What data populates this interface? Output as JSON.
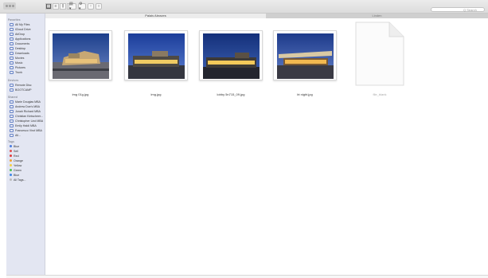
{
  "toolbar": {
    "view_seg_labels": [
      "▦",
      "≡",
      "⫼",
      "⊟"
    ],
    "arrange_label": "▤ ▾",
    "action_label": "⚙ ▾",
    "share_label": "↑",
    "tag_label": "○",
    "search_placeholder": "Q Search"
  },
  "tabs": [
    {
      "label": "Palais Abrazes"
    },
    {
      "label": "Linden"
    }
  ],
  "sidebar": {
    "favorites_title": "Favorites",
    "favorites": [
      "All My Files",
      "iCloud Drive",
      "AirDrop",
      "Applications",
      "Documents",
      "Desktop",
      "Downloads",
      "Movies",
      "Music",
      "Pictures",
      "Trunk"
    ],
    "devices_title": "Devices",
    "devices": [
      "Remote Disc",
      "BOOTCAMP"
    ],
    "shared_title": "Shared",
    "shared": [
      "Marie Douglas MBA",
      "Andrew Doe's MBA",
      "Jonah Richard MBA",
      "Christian Kintscheer...",
      "Christopher Lind MBA",
      "Emily Haldi MBA",
      "Francesco Virot MBA",
      "All..."
    ],
    "tags_title": "Tags",
    "tags": [
      {
        "label": "Blue",
        "color": "#4a7be0"
      },
      {
        "label": "Sell",
        "color": "#e05050"
      },
      {
        "label": "Red",
        "color": "#e03a3a"
      },
      {
        "label": "Orange",
        "color": "#f0a030"
      },
      {
        "label": "Yellow",
        "color": "#f5d040"
      },
      {
        "label": "Green",
        "color": "#50c050"
      },
      {
        "label": "Blue",
        "color": "#3b86e8"
      },
      {
        "label": "All Tags...",
        "color": "#bbbbbb"
      }
    ]
  },
  "files": [
    {
      "name": "img 01g.jpg"
    },
    {
      "name": "img.jpg"
    },
    {
      "name": "lobby 5n715_09.jpg"
    },
    {
      "name": "bt night.jpg"
    },
    {
      "name": "file_blank"
    }
  ]
}
